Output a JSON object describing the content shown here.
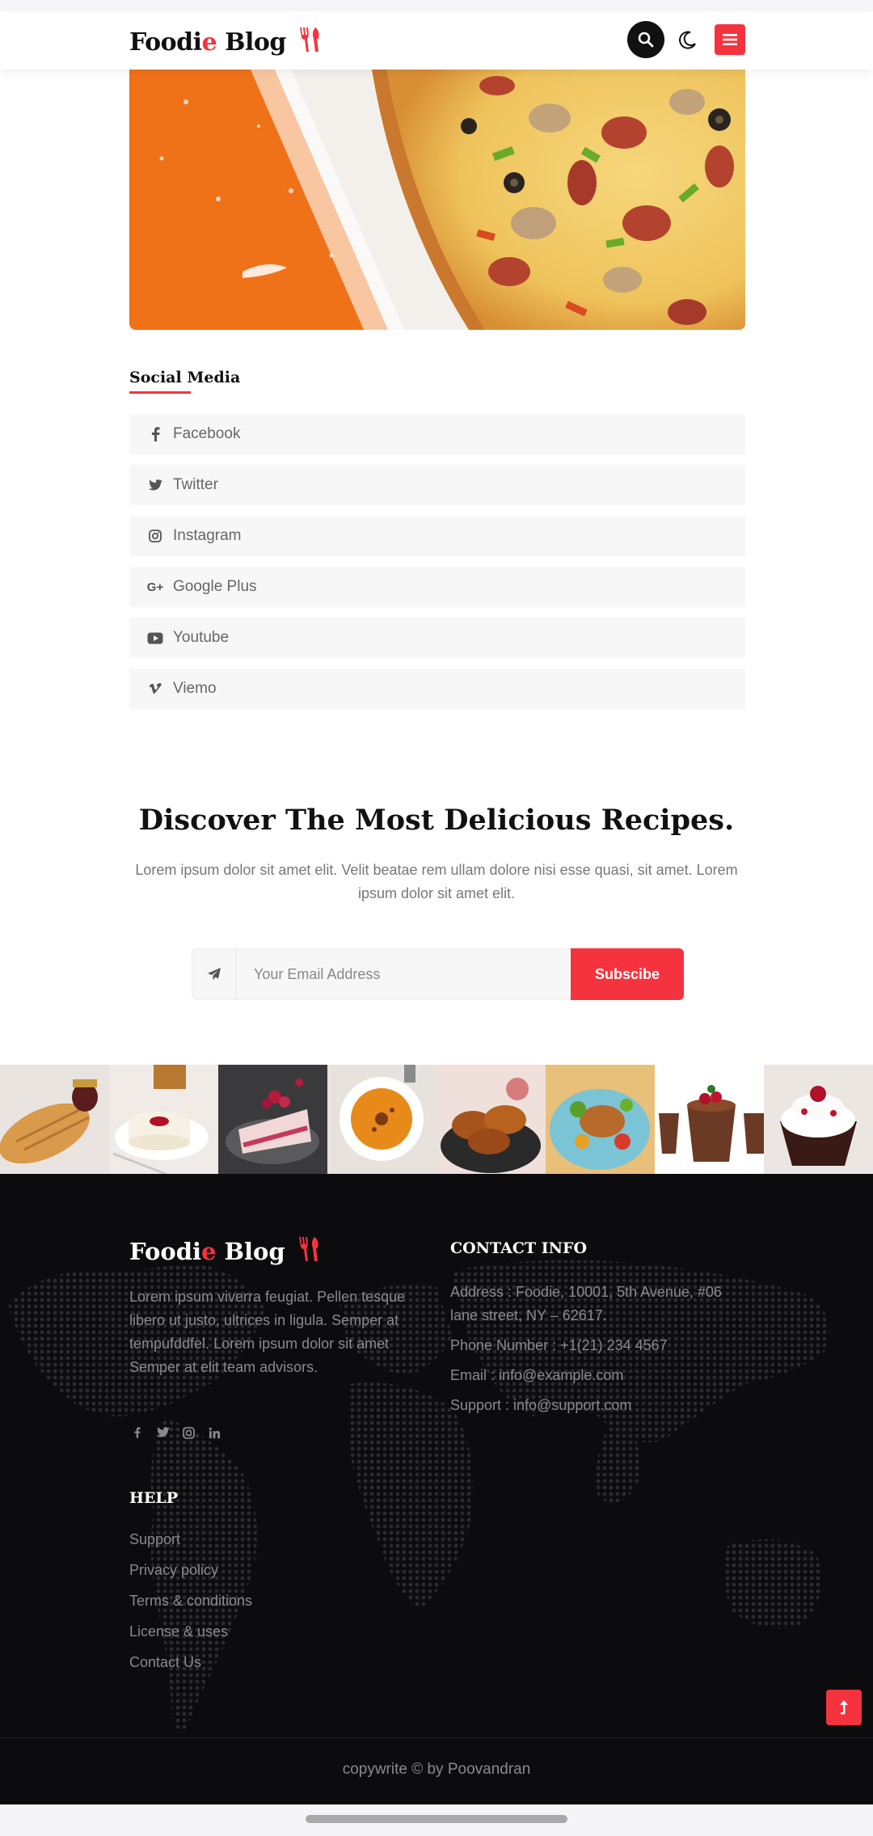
{
  "header": {
    "brand_main": "Foodi",
    "brand_accent": "e",
    "brand_tail": " Blog",
    "icons": [
      "search-icon",
      "moon-icon",
      "menu-icon"
    ]
  },
  "social": {
    "title": "Social Media",
    "items": [
      {
        "label": "Facebook",
        "icon": "facebook-icon"
      },
      {
        "label": "Twitter",
        "icon": "twitter-icon"
      },
      {
        "label": "Instagram",
        "icon": "instagram-icon"
      },
      {
        "label": "Google Plus",
        "icon": "google-plus-icon"
      },
      {
        "label": "Youtube",
        "icon": "youtube-icon"
      },
      {
        "label": "Viemo",
        "icon": "vimeo-icon"
      }
    ]
  },
  "newsletter": {
    "title": "Discover The Most Delicious Recipes.",
    "text": "Lorem ipsum dolor sit amet elit. Velit beatae rem ullam dolore nisi esse quasi, sit amet. Lorem ipsum dolor sit amet elit.",
    "placeholder": "Your Email Address",
    "button": "Subscibe"
  },
  "footer": {
    "brand_main": "Foodi",
    "brand_accent": "e",
    "brand_tail": " Blog",
    "about": "Lorem ipsum viverra feugiat. Pellen tesque libero ut justo, ultrices in ligula. Semper at tempufddfel. Lorem ipsum dolor sit amet Semper at elit team advisors.",
    "contact_title": "CONTACT INFO",
    "contact": [
      "Address : Foodie, 10001, 5th Avenue, #06 lane street, NY – 62617.",
      "Phone Number : +1(21) 234 4567",
      "Email : info@example.com",
      "Support : info@support.com"
    ],
    "help_title": "HELP",
    "help_links": [
      "Support",
      "Privacy policy",
      "Terms & conditions",
      "License & uses",
      "Contact Us"
    ],
    "copyright": "copywrite © by Poovandran"
  },
  "colors": {
    "accent": "#f5333f",
    "footer_bg": "#0c0c0e"
  }
}
